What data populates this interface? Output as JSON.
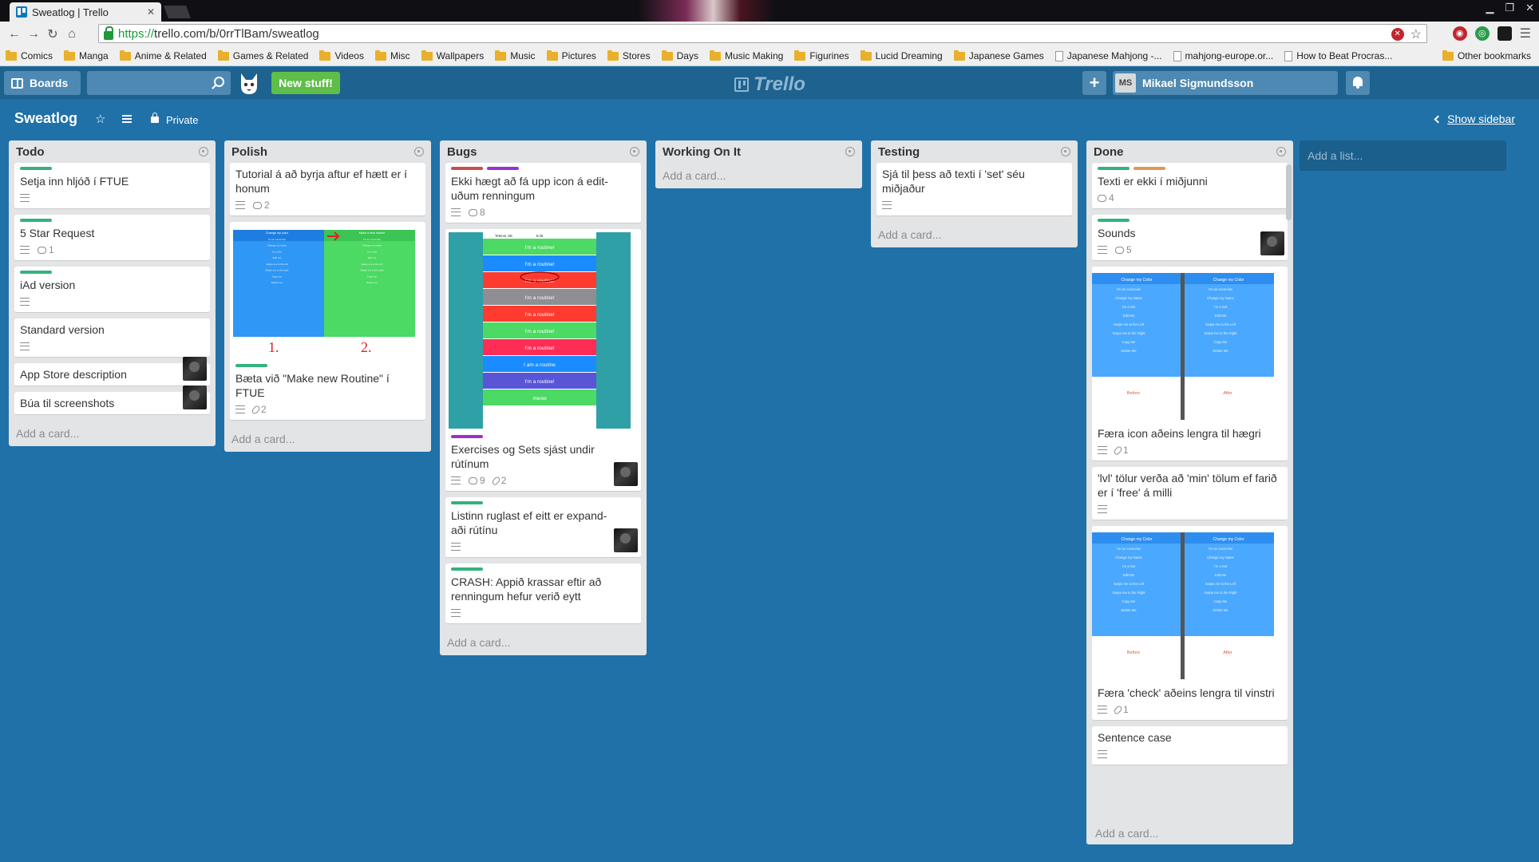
{
  "browser": {
    "tab_title": "Sweatlog | Trello",
    "url_https": "https://",
    "url_rest": "trello.com/b/0rrTlBam/sweatlog",
    "bookmarks": [
      "Comics",
      "Manga",
      "Anime & Related",
      "Games & Related",
      "Videos",
      "Misc",
      "Wallpapers",
      "Music",
      "Pictures",
      "Stores",
      "Days",
      "Music Making",
      "Figurines",
      "Lucid Dreaming",
      "Japanese Games"
    ],
    "bookmark_pages": [
      "Japanese Mahjong -...",
      "mahjong-europe.or...",
      "How to Beat Procras..."
    ],
    "other_bookmarks": "Other bookmarks"
  },
  "header": {
    "boards_label": "Boards",
    "new_stuff_label": "New stuff!",
    "logo_text": "Trello",
    "member_initials": "MS",
    "member_name": "Mikael Sigmundsson"
  },
  "board": {
    "title": "Sweatlog",
    "visibility": "Private",
    "show_sidebar": "Show sidebar",
    "add_list": "Add a list..."
  },
  "add_card_label": "Add a card...",
  "lists": [
    {
      "title": "Todo",
      "cards": [
        {
          "title": "Setja inn hljóð í FTUE",
          "labels": [
            "green"
          ],
          "desc": true
        },
        {
          "title": "5 Star Request",
          "labels": [
            "green"
          ],
          "desc": true,
          "comments": "1"
        },
        {
          "title": "iAd version",
          "labels": [
            "green"
          ],
          "desc": true
        },
        {
          "title": "Standard version",
          "labels": [],
          "desc": true
        },
        {
          "title": "App Store description",
          "labels": [],
          "avatar": true
        },
        {
          "title": "Búa til screenshots",
          "labels": [],
          "avatar": true
        }
      ]
    },
    {
      "title": "Polish",
      "cards": [
        {
          "title": "Tutorial á að byrja aftur ef hætt er í honum",
          "desc": true,
          "comments": "2"
        },
        {
          "title": "Bæta við \"Make new Routine\" í FTUE",
          "labels": [
            "green"
          ],
          "desc": true,
          "attachments": "2",
          "cover": "tutorial",
          "cover_text": {
            "left_header": "Change my color",
            "right_header": "Make a new routine",
            "rows": [
              "I'm an excercise",
              "Change my name",
              "I'm a Set",
              "Edit me",
              "Swipe me to the left",
              "Swipe me to the right",
              "Copy me",
              "Delete me"
            ],
            "mark1": "1.",
            "mark2": "2."
          }
        }
      ]
    },
    {
      "title": "Bugs",
      "cards": [
        {
          "title": "Ekki hægt að fá upp icon á edit-uðum renningum",
          "labels": [
            "red",
            "purple"
          ],
          "desc": true,
          "comments": "8"
        },
        {
          "title": "Exercises og Sets sjást undir rútínum",
          "labels": [
            "purple"
          ],
          "desc": true,
          "comments": "9",
          "attachments": "2",
          "avatar": true,
          "cover": "phone",
          "cover_text": {
            "status_carrier": "Telenor SE",
            "status_time": "8:35",
            "rows": [
              "I'm a routine!",
              "I'm a routine!",
              "I'm a routine!",
              "I'm a routine!",
              "I'm a routine!",
              "I'm a routine!",
              "I'm a routine!",
              "I am a routine",
              "I'm a routine!",
              "meow"
            ],
            "row_colors": [
              "#4cd964",
              "#1a8cff",
              "#ff3b30",
              "#8e8e93",
              "#ff3b30",
              "#4cd964",
              "#ff2d55",
              "#1a8cff",
              "#5856d6",
              "#4cd964"
            ]
          }
        },
        {
          "title": "Listinn ruglast ef eitt er expand-aði rútínu",
          "labels": [
            "green"
          ],
          "desc": true,
          "avatar": true
        },
        {
          "title": "CRASH: Appið krassar eftir að renningum hefur verið eytt",
          "labels": [
            "green"
          ],
          "desc": true
        }
      ]
    },
    {
      "title": "Working On It",
      "cards": []
    },
    {
      "title": "Testing",
      "cards": [
        {
          "title": "Sjá til þess að texti í 'set' séu miðjaður",
          "desc": true
        }
      ]
    },
    {
      "title": "Done",
      "cards": [
        {
          "title": "Texti er ekki í miðjunni",
          "labels": [
            "green",
            "orange"
          ],
          "comments": "4"
        },
        {
          "title": "Sounds",
          "labels": [
            "green"
          ],
          "desc": true,
          "comments": "5",
          "avatar": true
        },
        {
          "title": "Færa icon aðeins lengra til hægri",
          "desc": true,
          "attachments": "1",
          "cover": "beforeafter",
          "cover_text": {
            "header": "Change my Color",
            "rows": [
              "I'm an excercise",
              "Change my Name",
              "I'm a Set",
              "Edit Me",
              "Swipe me to the Left",
              "Swipe me to the Right",
              "Copy Me",
              "Delete Me"
            ],
            "before": "Before",
            "after": "After"
          }
        },
        {
          "title": "'lvl' tölur verða að 'min' tölum ef farið er í 'free' á milli",
          "desc": true
        },
        {
          "title": "Færa 'check' aðeins lengra til vinstri",
          "desc": true,
          "attachments": "1",
          "cover": "beforeafter",
          "cover_text": {
            "header": "Change my Color",
            "rows": [
              "I'm an excercise",
              "Change my Name",
              "I'm a Set",
              "Edit Me",
              "Swipe me to the Left",
              "Swipe me to the Right",
              "Copy Me",
              "Delete Me"
            ],
            "before": "Before",
            "after": "After"
          }
        },
        {
          "title": "Sentence case",
          "desc": true
        }
      ]
    }
  ],
  "colors": {
    "green": "#34b27d",
    "orange": "#e09952",
    "red": "#cb4d4d",
    "purple": "#9933cc",
    "board_bg": "#2071a8"
  }
}
